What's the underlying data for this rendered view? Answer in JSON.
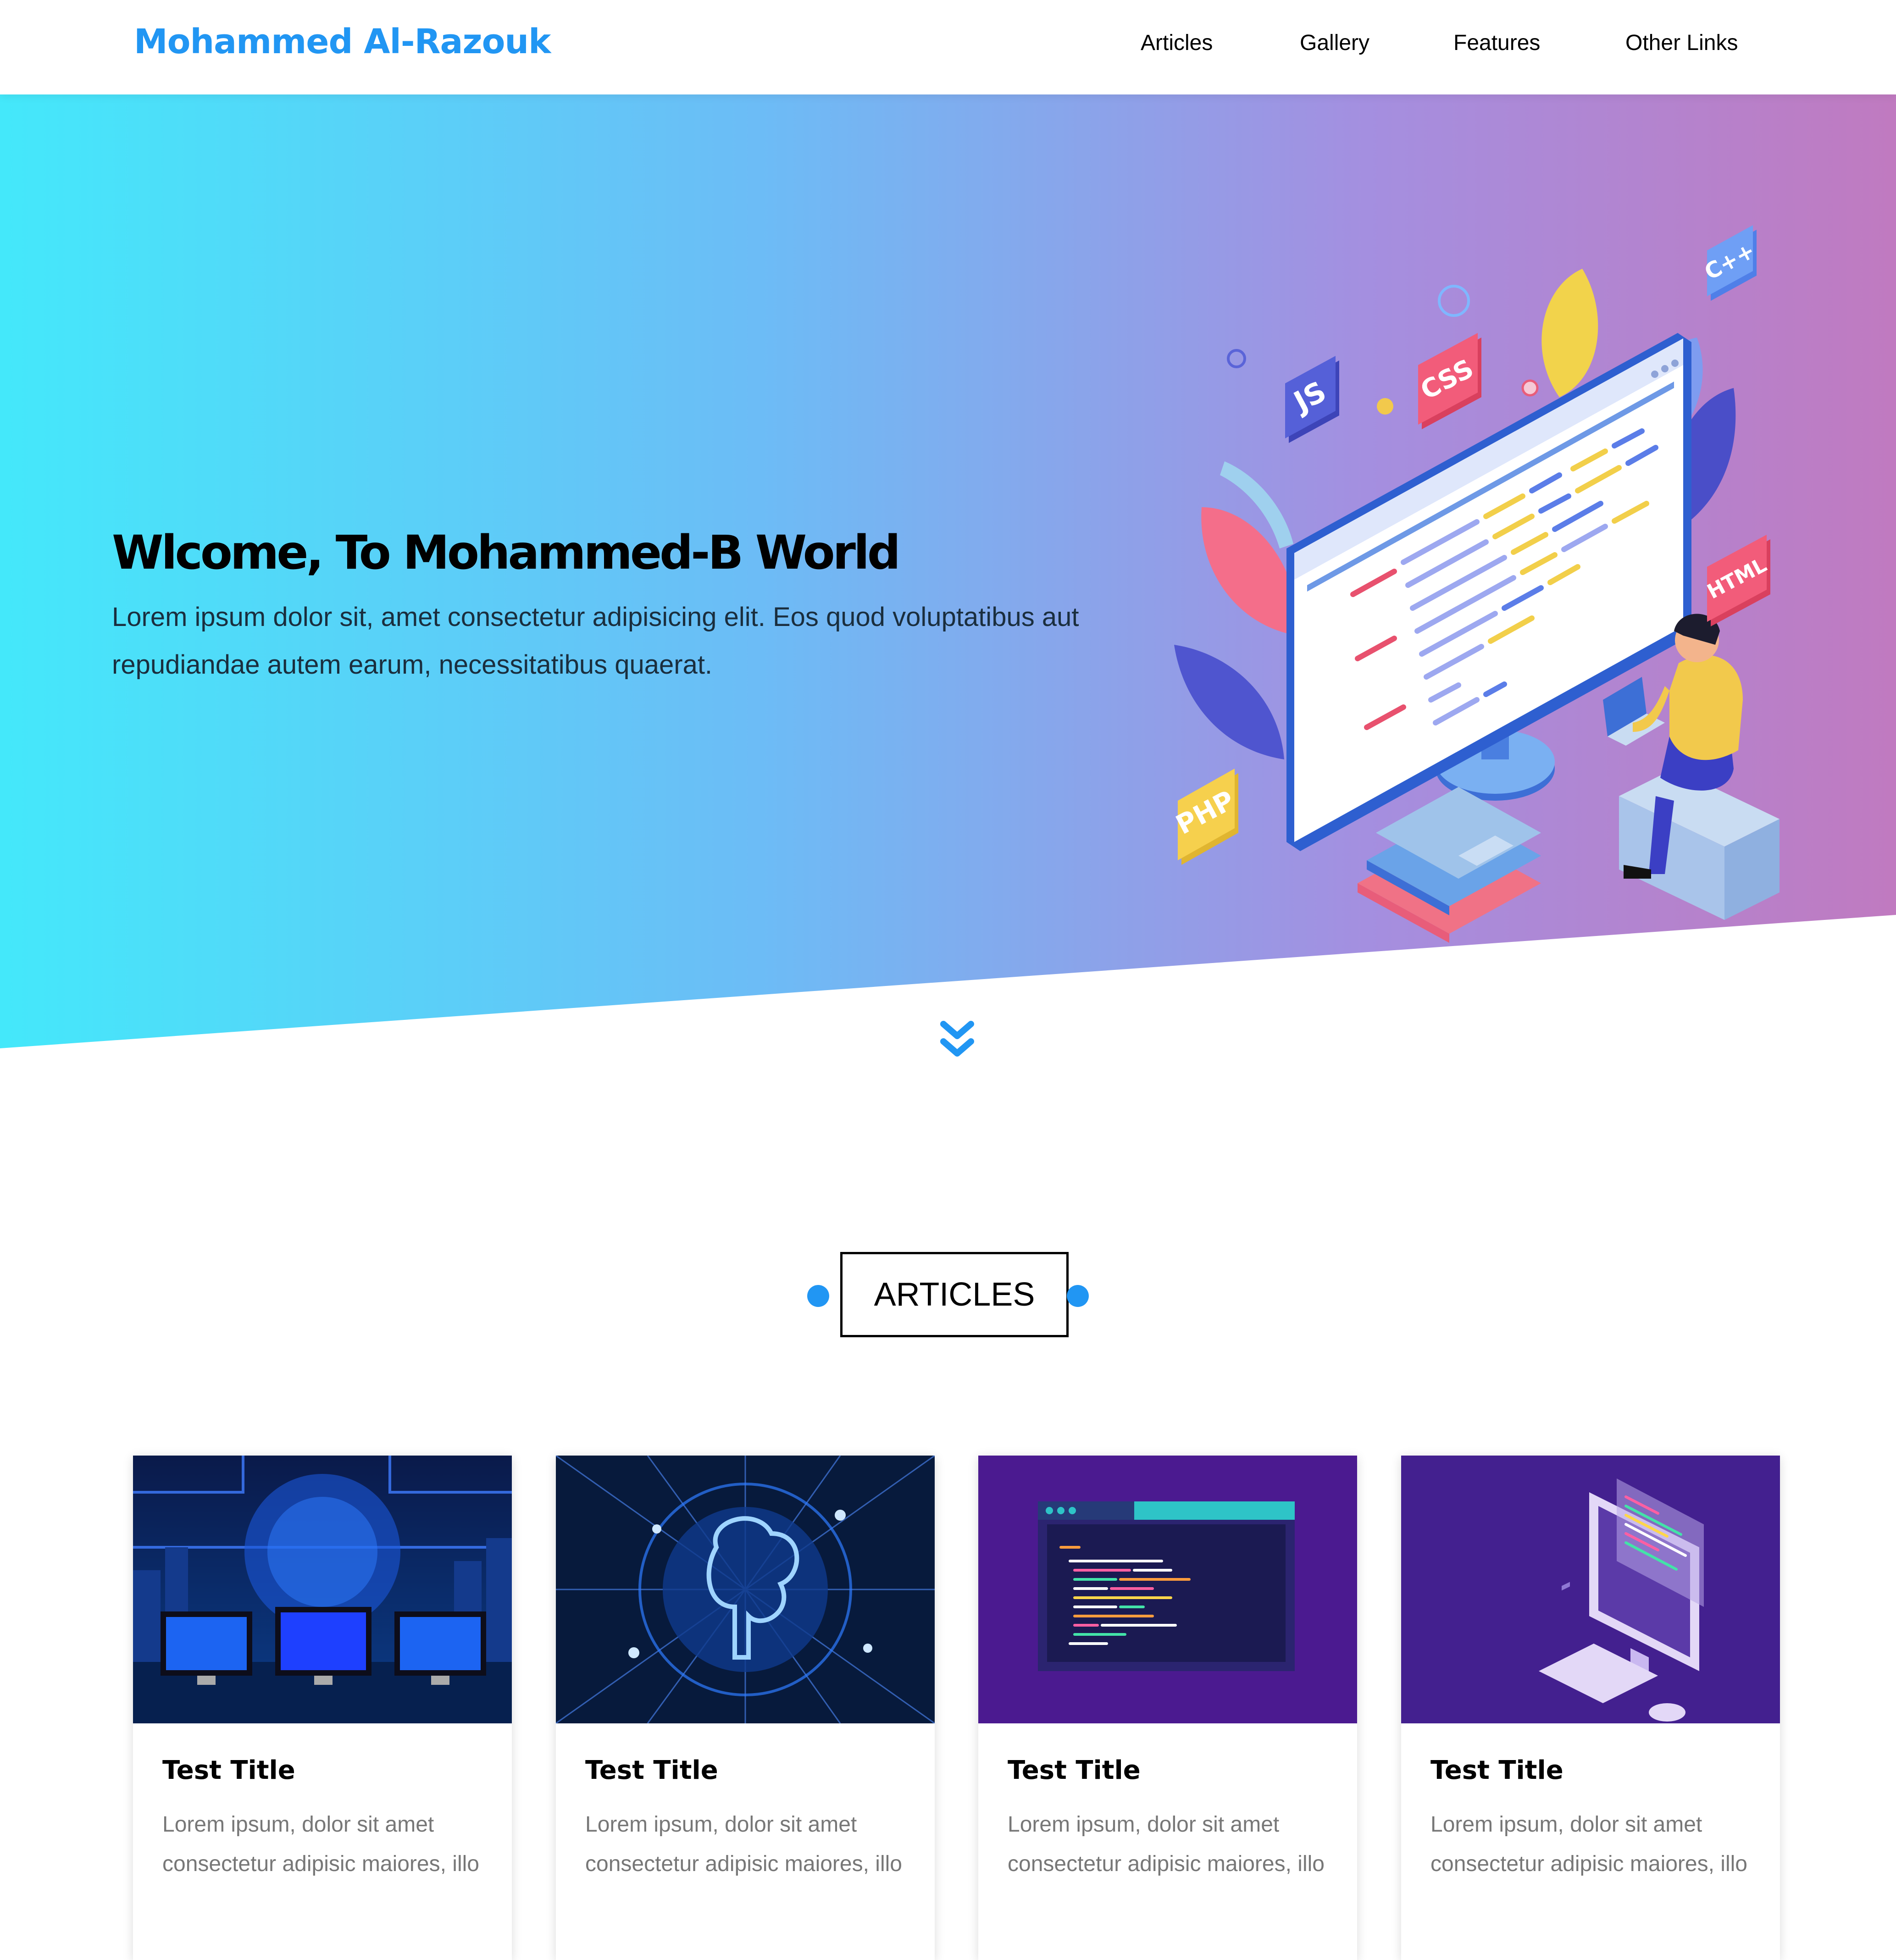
{
  "header": {
    "logo": "Mohammed Al-Razouk",
    "nav": [
      {
        "label": "Articles"
      },
      {
        "label": "Gallery"
      },
      {
        "label": "Features"
      },
      {
        "label": "Other Links"
      }
    ]
  },
  "hero": {
    "title": "Wlcome, To Mohammed-B World",
    "text": "Lorem ipsum dolor sit, amet consectetur adipisicing elit. Eos quod voluptatibus aut repudiandae autem earum, necessitatibus quaerat.",
    "badges": [
      "JS",
      "CSS",
      "C++",
      "HTML",
      "PHP"
    ]
  },
  "articles": {
    "heading": "ARTICLES",
    "cards": [
      {
        "title": "Test Title",
        "text": "Lorem ipsum, dolor sit amet consectetur adipisic maiores, illo"
      },
      {
        "title": "Test Title",
        "text": "Lorem ipsum, dolor sit amet consectetur adipisic maiores, illo"
      },
      {
        "title": "Test Title",
        "text": "Lorem ipsum, dolor sit amet consectetur adipisic maiores, illo"
      },
      {
        "title": "Test Title",
        "text": "Lorem ipsum, dolor sit amet consectetur adipisic maiores, illo"
      }
    ]
  },
  "colors": {
    "accent": "#2196f3",
    "gradient_start": "#44e8fa",
    "gradient_end": "#c07ac0"
  },
  "icons": {
    "scroll": "double-chevron-down-icon"
  }
}
